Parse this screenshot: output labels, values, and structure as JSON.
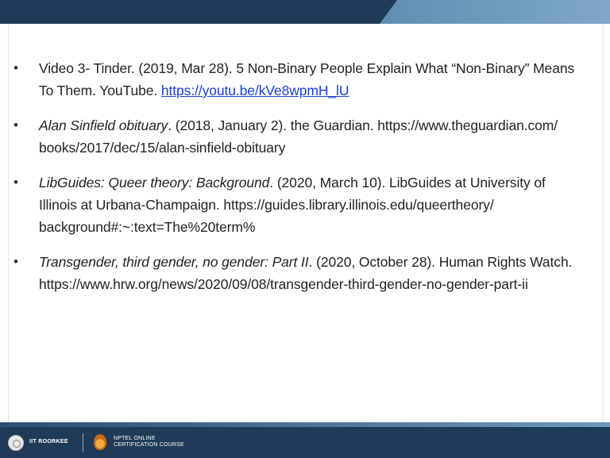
{
  "references": [
    {
      "prefix": "Video 3- Tinder. (2019, Mar 28). 5 Non-Binary People Explain What “Non-Binary” Means To Them. YouTube. ",
      "title": "",
      "rest": "",
      "link": "https://youtu.be/kVe8wpmH_lU"
    },
    {
      "prefix": "",
      "title": "Alan Sinfield obituary",
      "rest": ". (2018, January 2). the Guardian. https://www.theguardian.com/ books/2017/dec/15/alan-sinfield-obituary",
      "link": ""
    },
    {
      "prefix": "",
      "title": "LibGuides: Queer theory: Background",
      "rest": ". (2020, March 10). LibGuides at University of Illinois at Urbana-Champaign. https://guides.library.illinois.edu/queertheory/ background#:~:text=The%20term%",
      "link": ""
    },
    {
      "prefix": "",
      "title": "Transgender, third gender, no gender: Part II",
      "rest": ". (2020, October 28). Human Rights Watch. https://www.hrw.org/news/2020/09/08/transgender-third-gender-no-gender-part-ii",
      "link": ""
    }
  ],
  "bullet": "•",
  "footer": {
    "institute": "IIT ROORKEE",
    "course_line1": "NPTEL ONLINE",
    "course_line2": "CERTIFICATION COURSE"
  },
  "colors": {
    "header_bar": "#1f3b57",
    "link": "#1a3fd1",
    "text": "#222222"
  }
}
